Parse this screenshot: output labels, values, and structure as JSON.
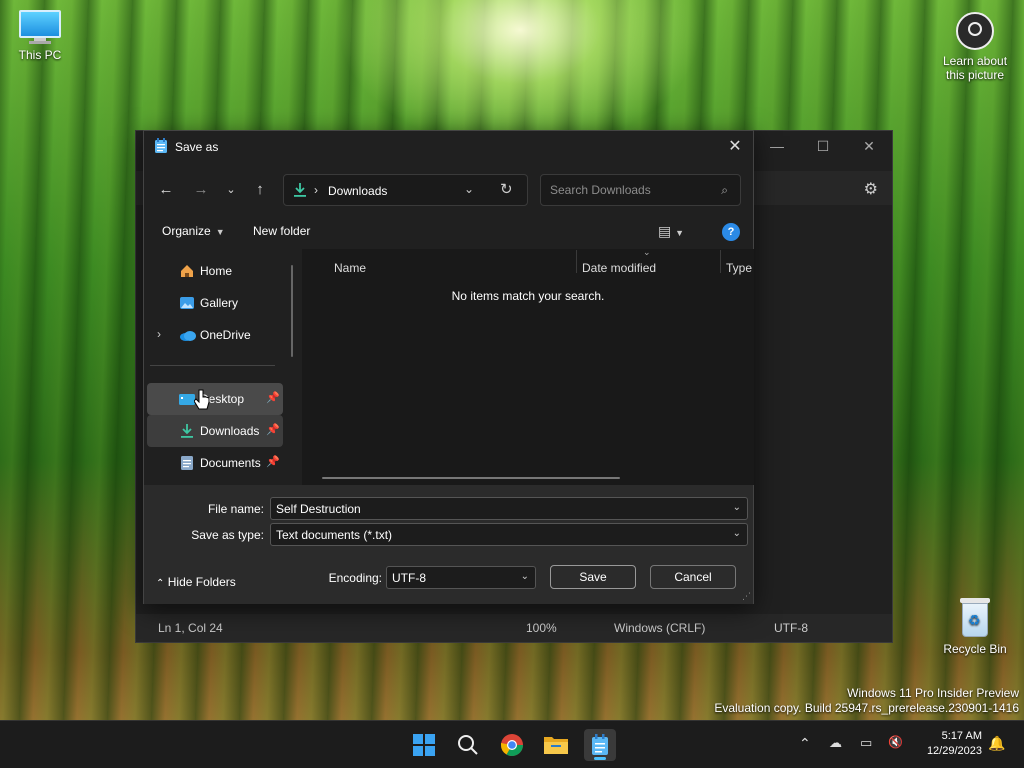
{
  "desktop": {
    "this_pc_label": "This PC",
    "learn_label_1": "Learn about",
    "learn_label_2": "this picture",
    "recycle_label": "Recycle Bin",
    "watermark_line1": "Windows 11 Pro Insider Preview",
    "watermark_line2": "Evaluation copy. Build 25947.rs_prerelease.230901-1416"
  },
  "notepad": {
    "status": {
      "position": "Ln 1, Col 24",
      "zoom": "100%",
      "line_ending": "Windows (CRLF)",
      "encoding": "UTF-8"
    }
  },
  "dialog": {
    "title": "Save as",
    "address": {
      "location": "Downloads"
    },
    "search": {
      "placeholder": "Search Downloads"
    },
    "commands": {
      "organize": "Organize",
      "new_folder": "New folder"
    },
    "nav": {
      "home": "Home",
      "gallery": "Gallery",
      "onedrive": "OneDrive",
      "desktop": "Desktop",
      "downloads": "Downloads",
      "documents": "Documents"
    },
    "columns": {
      "name": "Name",
      "date_modified": "Date modified",
      "type": "Type"
    },
    "empty_message": "No items match your search.",
    "form": {
      "file_name_label": "File name:",
      "file_name_value": "Self Destruction",
      "save_type_label": "Save as type:",
      "save_type_value": "Text documents (*.txt)",
      "encoding_label": "Encoding:",
      "encoding_value": "UTF-8",
      "save_button": "Save",
      "cancel_button": "Cancel",
      "hide_folders": "Hide Folders"
    }
  },
  "taskbar": {
    "time": "5:17 AM",
    "date": "12/29/2023"
  },
  "colors": {
    "accent": "#4cc2ff",
    "dialog_bg": "#202020",
    "help_blue": "#2b8ae6"
  }
}
